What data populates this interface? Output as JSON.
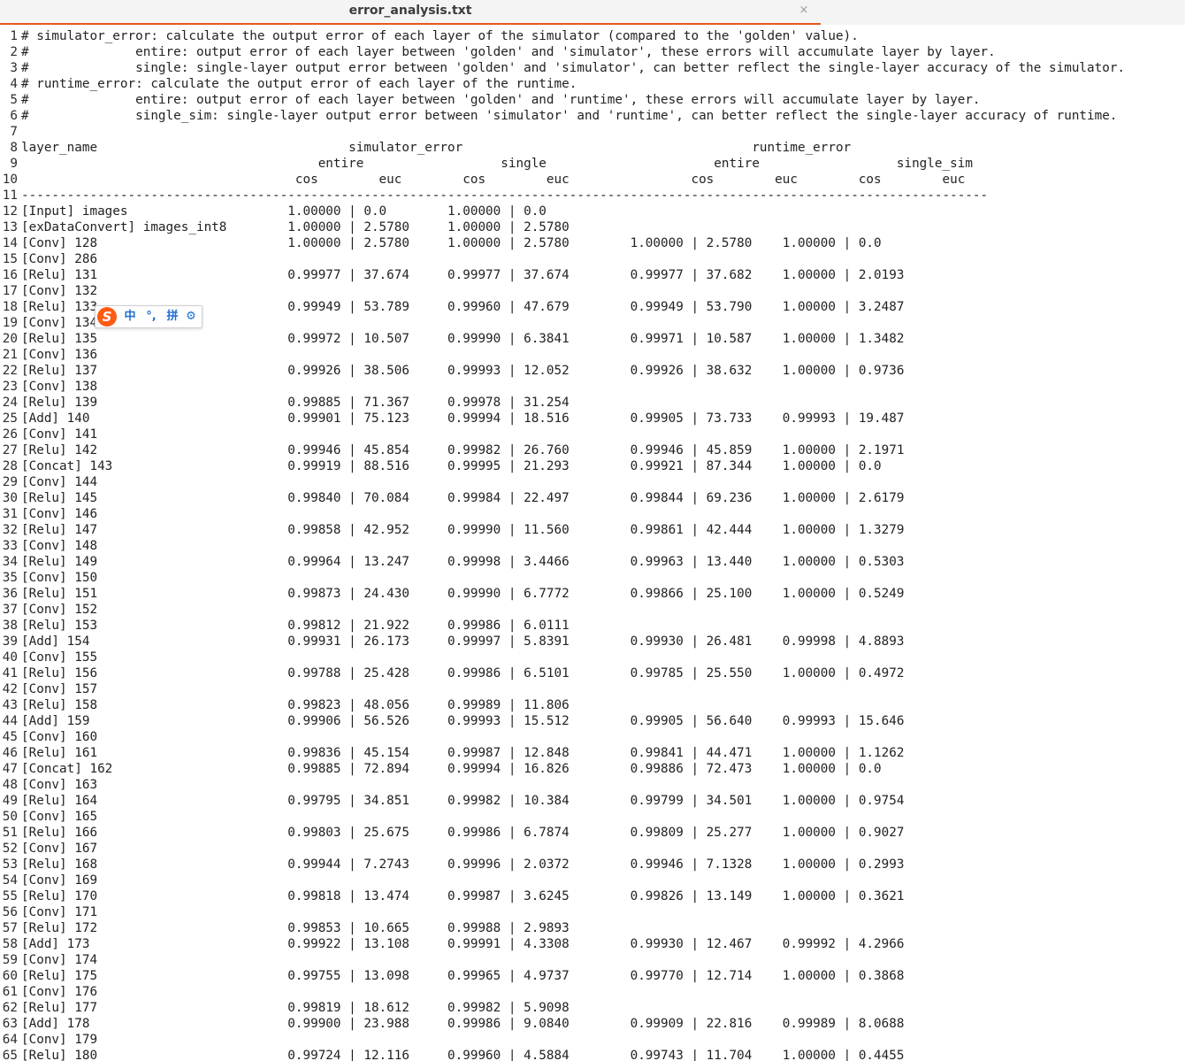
{
  "tab": {
    "title": "error_analysis.txt",
    "close_glyph": "×"
  },
  "ime": {
    "logo": "S",
    "chinese_mode": "中",
    "punctuation": "°,",
    "pinyin": "拼",
    "settings_icon": "gear-icon",
    "settings_glyph": "⚙"
  },
  "lines": [
    {
      "n": "1",
      "text": "# simulator_error: calculate the output error of each layer of the simulator (compared to the 'golden' value)."
    },
    {
      "n": "2",
      "text": "#              entire: output error of each layer between 'golden' and 'simulator', these errors will accumulate layer by layer."
    },
    {
      "n": "3",
      "text": "#              single: single-layer output error between 'golden' and 'simulator', can better reflect the single-layer accuracy of the simulator."
    },
    {
      "n": "4",
      "text": "# runtime_error: calculate the output error of each layer of the runtime."
    },
    {
      "n": "5",
      "text": "#              entire: output error of each layer between 'golden' and 'runtime', these errors will accumulate layer by layer."
    },
    {
      "n": "6",
      "text": "#              single_sim: single-layer output error between 'simulator' and 'runtime', can better reflect the single-layer accuracy of runtime."
    },
    {
      "n": "7",
      "text": ""
    },
    {
      "n": "8",
      "text": "layer_name                                 simulator_error                                      runtime_error"
    },
    {
      "n": "9",
      "text": "                                       entire                  single                      entire                  single_sim"
    },
    {
      "n": "10",
      "text": "                                    cos        euc        cos        euc                cos        euc        cos        euc"
    },
    {
      "n": "11",
      "text": "-------------------------------------------------------------------------------------------------------------------------------"
    },
    {
      "n": "12",
      "text": "[Input] images                     1.00000 | 0.0        1.00000 | 0.0"
    },
    {
      "n": "13",
      "text": "[exDataConvert] images_int8        1.00000 | 2.5780     1.00000 | 2.5780"
    },
    {
      "n": "14",
      "text": "[Conv] 128                         1.00000 | 2.5780     1.00000 | 2.5780        1.00000 | 2.5780    1.00000 | 0.0"
    },
    {
      "n": "15",
      "text": "[Conv] 286"
    },
    {
      "n": "16",
      "text": "[Relu] 131                         0.99977 | 37.674     0.99977 | 37.674        0.99977 | 37.682    1.00000 | 2.0193"
    },
    {
      "n": "17",
      "text": "[Conv] 132"
    },
    {
      "n": "18",
      "text": "[Relu] 133                         0.99949 | 53.789     0.99960 | 47.679        0.99949 | 53.790    1.00000 | 3.2487"
    },
    {
      "n": "19",
      "text": "[Conv] 134"
    },
    {
      "n": "20",
      "text": "[Relu] 135                         0.99972 | 10.507     0.99990 | 6.3841        0.99971 | 10.587    1.00000 | 1.3482"
    },
    {
      "n": "21",
      "text": "[Conv] 136"
    },
    {
      "n": "22",
      "text": "[Relu] 137                         0.99926 | 38.506     0.99993 | 12.052        0.99926 | 38.632    1.00000 | 0.9736"
    },
    {
      "n": "23",
      "text": "[Conv] 138"
    },
    {
      "n": "24",
      "text": "[Relu] 139                         0.99885 | 71.367     0.99978 | 31.254"
    },
    {
      "n": "25",
      "text": "[Add] 140                          0.99901 | 75.123     0.99994 | 18.516        0.99905 | 73.733    0.99993 | 19.487"
    },
    {
      "n": "26",
      "text": "[Conv] 141"
    },
    {
      "n": "27",
      "text": "[Relu] 142                         0.99946 | 45.854     0.99982 | 26.760        0.99946 | 45.859    1.00000 | 2.1971"
    },
    {
      "n": "28",
      "text": "[Concat] 143                       0.99919 | 88.516     0.99995 | 21.293        0.99921 | 87.344    1.00000 | 0.0"
    },
    {
      "n": "29",
      "text": "[Conv] 144"
    },
    {
      "n": "30",
      "text": "[Relu] 145                         0.99840 | 70.084     0.99984 | 22.497        0.99844 | 69.236    1.00000 | 2.6179"
    },
    {
      "n": "31",
      "text": "[Conv] 146"
    },
    {
      "n": "32",
      "text": "[Relu] 147                         0.99858 | 42.952     0.99990 | 11.560        0.99861 | 42.444    1.00000 | 1.3279"
    },
    {
      "n": "33",
      "text": "[Conv] 148"
    },
    {
      "n": "34",
      "text": "[Relu] 149                         0.99964 | 13.247     0.99998 | 3.4466        0.99963 | 13.440    1.00000 | 0.5303"
    },
    {
      "n": "35",
      "text": "[Conv] 150"
    },
    {
      "n": "36",
      "text": "[Relu] 151                         0.99873 | 24.430     0.99990 | 6.7772        0.99866 | 25.100    1.00000 | 0.5249"
    },
    {
      "n": "37",
      "text": "[Conv] 152"
    },
    {
      "n": "38",
      "text": "[Relu] 153                         0.99812 | 21.922     0.99986 | 6.0111"
    },
    {
      "n": "39",
      "text": "[Add] 154                          0.99931 | 26.173     0.99997 | 5.8391        0.99930 | 26.481    0.99998 | 4.8893"
    },
    {
      "n": "40",
      "text": "[Conv] 155"
    },
    {
      "n": "41",
      "text": "[Relu] 156                         0.99788 | 25.428     0.99986 | 6.5101        0.99785 | 25.550    1.00000 | 0.4972"
    },
    {
      "n": "42",
      "text": "[Conv] 157"
    },
    {
      "n": "43",
      "text": "[Relu] 158                         0.99823 | 48.056     0.99989 | 11.806"
    },
    {
      "n": "44",
      "text": "[Add] 159                          0.99906 | 56.526     0.99993 | 15.512        0.99905 | 56.640    0.99993 | 15.646"
    },
    {
      "n": "45",
      "text": "[Conv] 160"
    },
    {
      "n": "46",
      "text": "[Relu] 161                         0.99836 | 45.154     0.99987 | 12.848        0.99841 | 44.471    1.00000 | 1.1262"
    },
    {
      "n": "47",
      "text": "[Concat] 162                       0.99885 | 72.894     0.99994 | 16.826        0.99886 | 72.473    1.00000 | 0.0"
    },
    {
      "n": "48",
      "text": "[Conv] 163"
    },
    {
      "n": "49",
      "text": "[Relu] 164                         0.99795 | 34.851     0.99982 | 10.384        0.99799 | 34.501    1.00000 | 0.9754"
    },
    {
      "n": "50",
      "text": "[Conv] 165"
    },
    {
      "n": "51",
      "text": "[Relu] 166                         0.99803 | 25.675     0.99986 | 6.7874        0.99809 | 25.277    1.00000 | 0.9027"
    },
    {
      "n": "52",
      "text": "[Conv] 167"
    },
    {
      "n": "53",
      "text": "[Relu] 168                         0.99944 | 7.2743     0.99996 | 2.0372        0.99946 | 7.1328    1.00000 | 0.2993"
    },
    {
      "n": "54",
      "text": "[Conv] 169"
    },
    {
      "n": "55",
      "text": "[Relu] 170                         0.99818 | 13.474     0.99987 | 3.6245        0.99826 | 13.149    1.00000 | 0.3621"
    },
    {
      "n": "56",
      "text": "[Conv] 171"
    },
    {
      "n": "57",
      "text": "[Relu] 172                         0.99853 | 10.665     0.99988 | 2.9893"
    },
    {
      "n": "58",
      "text": "[Add] 173                          0.99922 | 13.108     0.99991 | 4.3308        0.99930 | 12.467    0.99992 | 4.2966"
    },
    {
      "n": "59",
      "text": "[Conv] 174"
    },
    {
      "n": "60",
      "text": "[Relu] 175                         0.99755 | 13.098     0.99965 | 4.9737        0.99770 | 12.714    1.00000 | 0.3868"
    },
    {
      "n": "61",
      "text": "[Conv] 176"
    },
    {
      "n": "62",
      "text": "[Relu] 177                         0.99819 | 18.612     0.99982 | 5.9098"
    },
    {
      "n": "63",
      "text": "[Add] 178                          0.99900 | 23.988     0.99986 | 9.0840        0.99909 | 22.816    0.99989 | 8.0688"
    },
    {
      "n": "64",
      "text": "[Conv] 179"
    },
    {
      "n": "65",
      "text": "[Relu] 180                         0.99724 | 12.116     0.99960 | 4.5884        0.99743 | 11.704    1.00000 | 0.4455"
    }
  ]
}
